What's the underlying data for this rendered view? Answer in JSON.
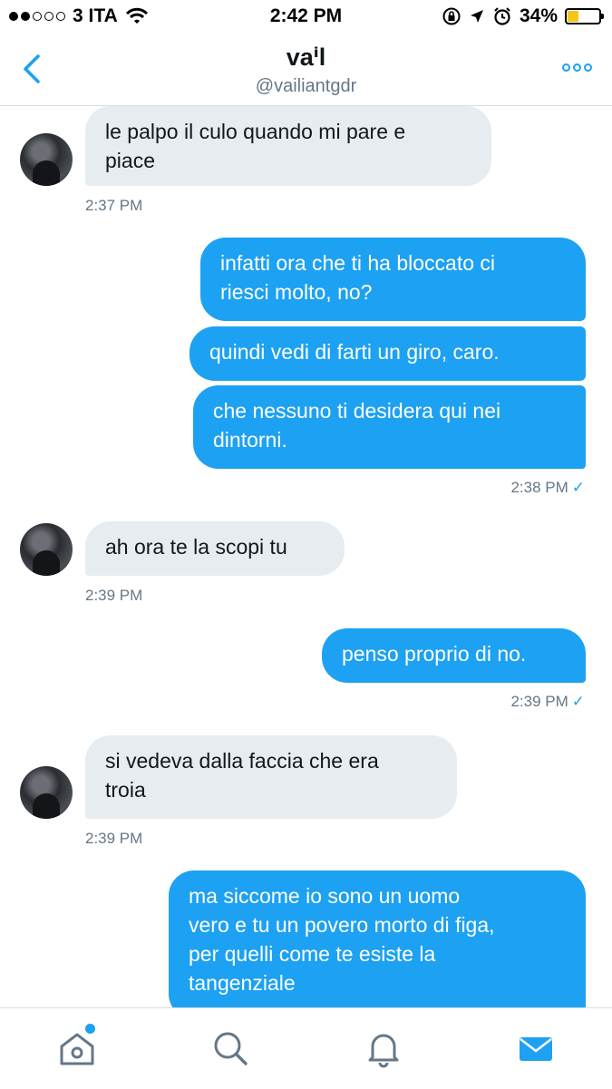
{
  "status_bar": {
    "carrier": "3 ITA",
    "time": "2:42 PM",
    "battery": "34%",
    "battery_level": 0.34,
    "signal_bars_filled": 2,
    "signal_bars_total": 5
  },
  "header": {
    "title": "vaⁱl",
    "handle": "@vailiantgdr"
  },
  "colors": {
    "accent": "#1da1f2",
    "incoming_bubble": "#e6ecf0",
    "timestamp": "#657786"
  },
  "messages": [
    {
      "direction": "in",
      "lines": [
        "le palpo il culo quando mi pare e",
        "piace"
      ]
    },
    {
      "direction": "out",
      "lines": [
        "infatti ora che ti ha bloccato ci",
        "riesci molto, no?"
      ]
    },
    {
      "direction": "out",
      "lines": [
        "quindi vedi di farti un giro, caro."
      ]
    },
    {
      "direction": "out",
      "lines": [
        "che nessuno ti desidera qui nei",
        "dintorni."
      ]
    },
    {
      "direction": "in",
      "lines": [
        "ah ora te la scopi tu"
      ]
    },
    {
      "direction": "out",
      "lines": [
        "penso proprio di no."
      ]
    },
    {
      "direction": "in",
      "lines": [
        "si vedeva dalla faccia che era",
        "troia"
      ]
    },
    {
      "direction": "out",
      "lines": [
        "ma siccome io sono un uomo",
        "vero e tu un povero morto di figa,",
        "per quelli come te esiste la",
        "tangenziale"
      ]
    }
  ],
  "timestamps": {
    "t1": "2:37 PM",
    "t2": "2:38 PM",
    "t3": "2:39 PM",
    "t4": "2:39 PM",
    "t5": "2:39 PM",
    "read_mark": "✓"
  },
  "tabbar": {
    "items": [
      "home-icon",
      "search-icon",
      "notifications-icon",
      "messages-icon"
    ],
    "active": "messages-icon"
  }
}
